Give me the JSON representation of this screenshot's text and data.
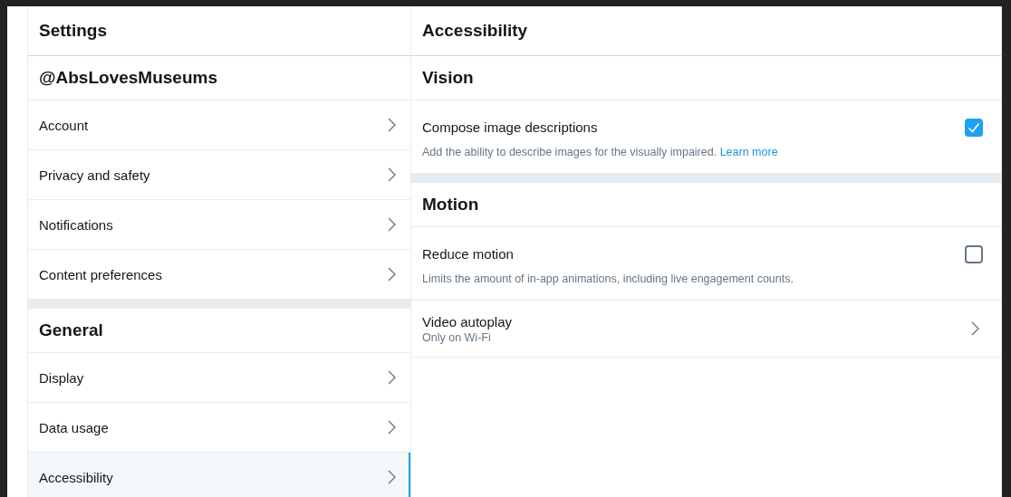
{
  "sidebar": {
    "title": "Settings",
    "sections": [
      {
        "title": "@AbsLovesMuseums",
        "items": [
          {
            "label": "Account",
            "selected": false
          },
          {
            "label": "Privacy and safety",
            "selected": false
          },
          {
            "label": "Notifications",
            "selected": false
          },
          {
            "label": "Content preferences",
            "selected": false
          }
        ]
      },
      {
        "title": "General",
        "items": [
          {
            "label": "Display",
            "selected": false
          },
          {
            "label": "Data usage",
            "selected": false
          },
          {
            "label": "Accessibility",
            "selected": true
          }
        ]
      }
    ]
  },
  "detail": {
    "title": "Accessibility",
    "sections": [
      {
        "title": "Vision",
        "settings": [
          {
            "kind": "checkbox",
            "label": "Compose image descriptions",
            "checked": true,
            "description": "Add the ability to describe images for the visually impaired.",
            "link": "Learn more"
          }
        ]
      },
      {
        "title": "Motion",
        "settings": [
          {
            "kind": "checkbox",
            "label": "Reduce motion",
            "checked": false,
            "description": "Limits the amount of in-app animations, including live engagement counts."
          },
          {
            "kind": "link",
            "label": "Video autoplay",
            "value": "Only on Wi-Fi"
          }
        ]
      }
    ]
  }
}
